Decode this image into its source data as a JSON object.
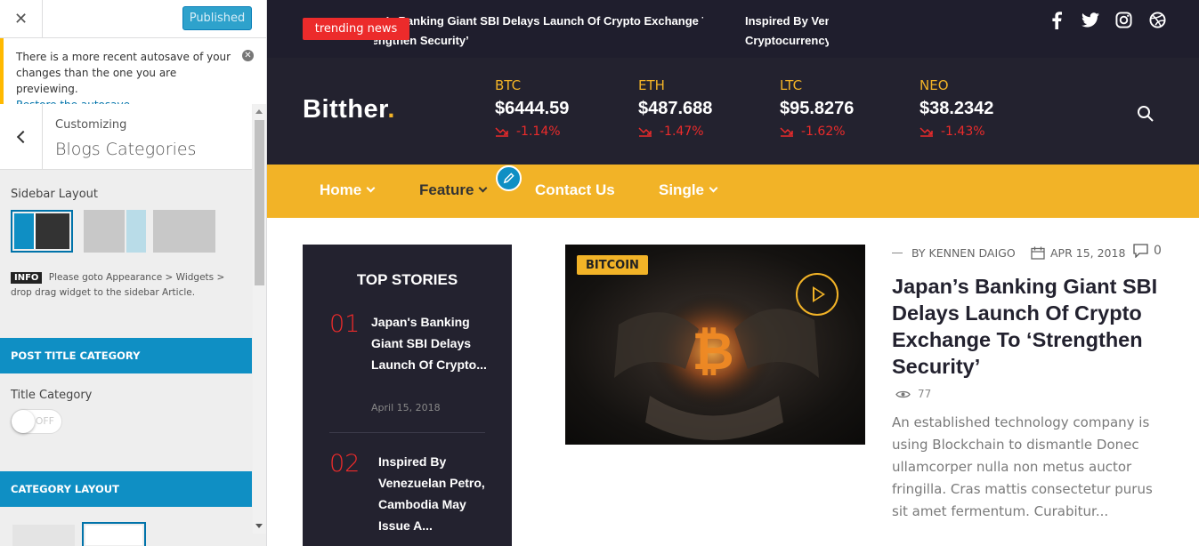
{
  "customizer": {
    "publish_label": "Published",
    "notice": {
      "text": "There is a more recent autosave of your changes than the one you are previewing.",
      "link": "Restore the autosave"
    },
    "breadcrumb": "Customizing",
    "section_title": "Blogs Categories",
    "sidebar_layout_label": "Sidebar Layout",
    "info_badge": "INFO",
    "info_text": "Please goto Appearance > Widgets > drop drag widget to the sidebar Article.",
    "post_title_category_bar": "POST TITLE CATEGORY",
    "title_category_label": "Title Category",
    "toggle_state": "OFF",
    "category_layout_bar": "CATEGORY LAYOUT",
    "colors": {
      "accent": "#0f8fc4",
      "selected_border": "#0073aa",
      "notice": "#ffb900"
    }
  },
  "site": {
    "trending_label": "trending news",
    "ticker": [
      {
        "line1": "Japan’s Banking Giant SBI Delays Launch Of Crypto Exchange To",
        "line2": "‘Strengthen Security’"
      },
      {
        "line1": "Inspired By Venezuelan Petro, Cambodia May Issue A",
        "line2": "Cryptocurrency"
      }
    ],
    "social_icons": [
      "facebook-icon",
      "twitter-icon",
      "instagram-icon",
      "dribbble-icon"
    ],
    "logo": {
      "text": "Bitther",
      "dot": "."
    },
    "coins": [
      {
        "symbol": "BTC",
        "price": "$6444.59",
        "change": "-1.14%"
      },
      {
        "symbol": "ETH",
        "price": "$487.688",
        "change": "-1.47%"
      },
      {
        "symbol": "LTC",
        "price": "$95.8276",
        "change": "-1.62%"
      },
      {
        "symbol": "NEO",
        "price": "$38.2342",
        "change": "-1.43%"
      }
    ],
    "nav": [
      {
        "label": "Home",
        "dropdown": true
      },
      {
        "label": "Feature",
        "dropdown": true
      },
      {
        "label": "Contact Us",
        "dropdown": false
      },
      {
        "label": "Single",
        "dropdown": true
      }
    ],
    "top_stories": {
      "title": "TOP STORIES",
      "items": [
        {
          "num": "01",
          "title": "Japan's Banking Giant SBI Delays Launch Of Crypto...",
          "date": "April 15, 2018"
        },
        {
          "num": "02",
          "title": "Inspired By Venezuelan Petro, Cambodia May Issue A..."
        }
      ]
    },
    "featured": {
      "category": "BITCOIN",
      "author": "BY KENNEN DAIGO",
      "date": "APR 15, 2018",
      "comments": "0",
      "title": "Japan’s Banking Giant SBI Delays Launch Of Crypto Exchange To ‘Strengthen Security’",
      "views": "77",
      "excerpt": "An established technology company is using Blockchain to dismantle Donec ullamcorper nulla non metus auctor fringilla. Cras mattis consectetur purus sit amet fermentum. Curabitur..."
    },
    "colors": {
      "dark": "#1f1e2d",
      "header": "#23222f",
      "gold": "#f2b327",
      "red": "#ec2b2b"
    }
  }
}
